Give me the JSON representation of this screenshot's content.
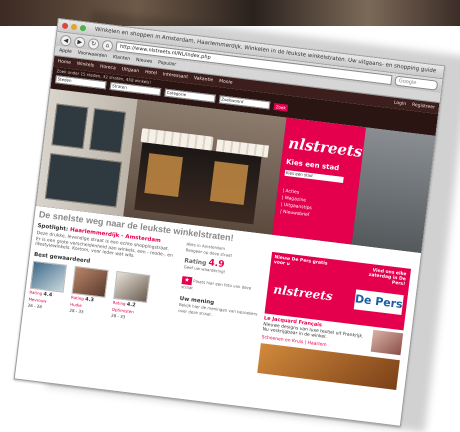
{
  "browser": {
    "title": "Winkelen en shoppen in Amsterdam, Haarlemmerdijk. Winkelen in de leukste winkelstraten. Uw uitgaans- en shopping guide",
    "url": "http://www.nlstreets.nl/NL/index.php",
    "search_placeholder": "Google",
    "bookmarks": [
      "Apple",
      "Voorwaarden",
      "Klanten",
      "Nieuws",
      "Populair"
    ]
  },
  "site": {
    "nav": [
      "Home",
      "Winkels",
      "Horeca",
      "Uitgaan",
      "Hotel",
      "Interessant",
      "Vakantie",
      "Mooie"
    ],
    "nav_right": [
      "Login",
      "Registreer"
    ],
    "sub_text": "Zoek onder 15 steden, 32 straten, 458 winkels!",
    "filter_labels": [
      "Steden",
      "Straten",
      "Categorie",
      "Zoekwoord"
    ],
    "search_button": "Zoek",
    "brand": "nlstreets",
    "kies_label": "Kies een stad",
    "stad_placeholder": "Kies een stad",
    "pink_links": [
      "| Acties",
      "| Magazine",
      "| Uitgaanstips",
      "| Nieuwsbrief"
    ],
    "headline": "De snelste weg naar de leukste winkelstraten!",
    "spotlight_label": "Spotlight:",
    "spotlight_city": "Haarlemmerdijk - Amsterdam",
    "paragraph": "Deze drukke, levendige straat is een echte shoppingstraat. Er is een grote verscheidenheid aan winkels, een - mode-, en lifestylewinkels. Kortom, voor ieder wat wils.",
    "side_mini": [
      "Alles in Amsterdam",
      "Reageer op deze straat"
    ],
    "gewaardeerd": "Best gewaardeerd",
    "thumbs": [
      {
        "rating": "4.4",
        "name": "Mevrouw",
        "address": "26 - 28"
      },
      {
        "rating": "4.3",
        "name": "Hudie",
        "address": "28 - 33"
      },
      {
        "rating": "4.2",
        "name": "Optimisten",
        "address": "28 - 33"
      }
    ],
    "rating_label": "Rating",
    "rating_value": "4.9",
    "rating_note": "Geef uw waardering!",
    "star_label": "Plaats hier een foto van deze straat",
    "mening_title": "Uw mening",
    "mening_text": "Bekijk hier de meningen van bezoekers over deze straat.",
    "ad": {
      "left": "Nieuw De Pers gratis voor u",
      "right": "Vind ons elke zaterdag in De Pers!",
      "brand": "nlstreets",
      "paper": "De Pers"
    },
    "news": {
      "title": "Le Jacquard Français",
      "body": "Nieuwe designs van luxe textiel uit Frankrijk. Nu verkrijgbaar in de winkel.",
      "link": "Schoenen en Kruis | Haarlem"
    }
  }
}
